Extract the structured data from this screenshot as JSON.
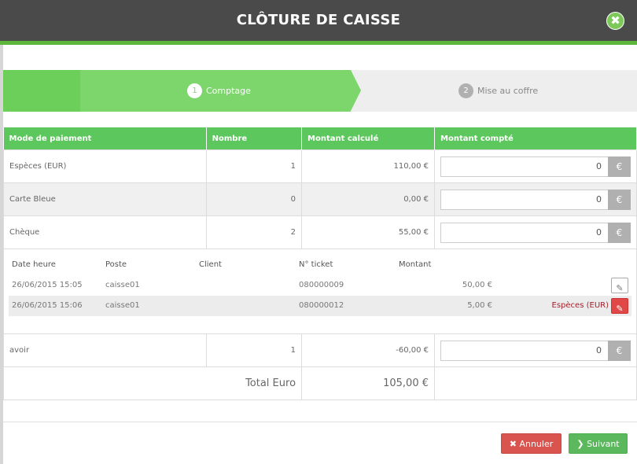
{
  "dialog": {
    "title": "CLÔTURE DE CAISSE",
    "close_icon": "✖"
  },
  "steps": [
    {
      "number": "1",
      "label": "Comptage",
      "state": "active"
    },
    {
      "number": "2",
      "label": "Mise au coffre",
      "state": "pending"
    }
  ],
  "table": {
    "headers": [
      "Mode de paiement",
      "Nombre",
      "Montant calculé",
      "Montant compté"
    ],
    "rows": [
      {
        "mode": "Espèces (EUR)",
        "count": "1",
        "computed": "110,00 €",
        "counted": "0"
      },
      {
        "mode": "Carte Bleue",
        "count": "0",
        "computed": "0,00 €",
        "counted": "0"
      },
      {
        "mode": "Chèque",
        "count": "2",
        "computed": "55,00 €",
        "counted": "0"
      },
      {
        "mode": "avoir",
        "count": "1",
        "computed": "-60,00 €",
        "counted": "0"
      }
    ],
    "currency_button": "€",
    "total_label": "Total Euro",
    "total_value": "105,00 €"
  },
  "cheque_detail": {
    "headers": [
      "Date heure",
      "Poste",
      "Client",
      "N° ticket",
      "Montant"
    ],
    "rows": [
      {
        "datetime": "26/06/2015 15:05",
        "poste": "caisse01",
        "client": "",
        "ticket": "080000009",
        "amount": "50,00 €",
        "payment_label": ""
      },
      {
        "datetime": "26/06/2015 15:06",
        "poste": "caisse01",
        "client": "",
        "ticket": "080000012",
        "amount": "5,00 €",
        "payment_label": "Espèces (EUR)"
      }
    ],
    "edit_icon": "✎"
  },
  "footer": {
    "cancel_label": "Annuler",
    "cancel_icon": "✖",
    "next_label": "Suivant",
    "next_icon": "❯"
  },
  "colors": {
    "accent_green": "#5cc75c",
    "title_bar": "#4a4a4a",
    "danger": "#d9534f",
    "success": "#5cb85c"
  }
}
